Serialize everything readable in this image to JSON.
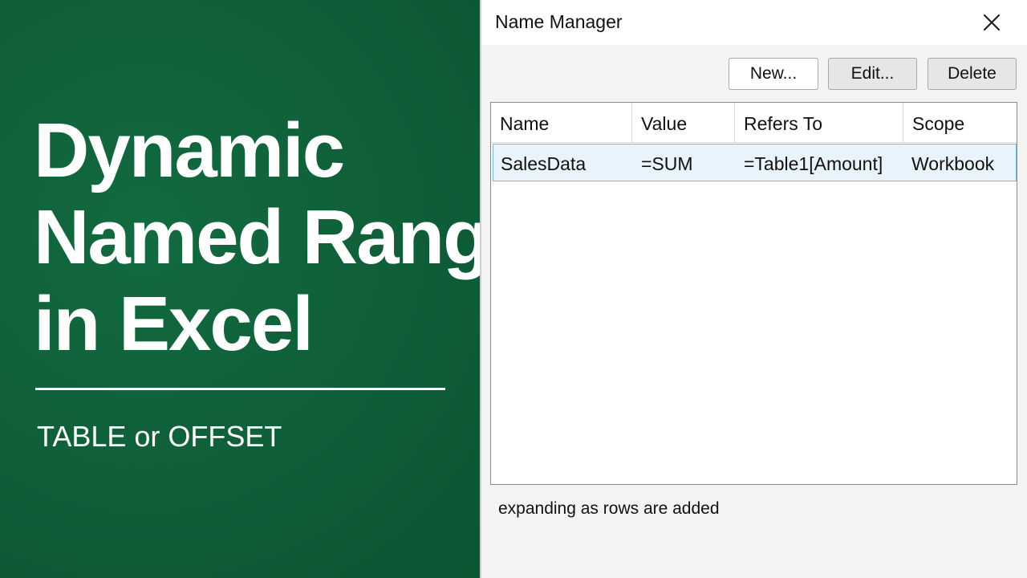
{
  "slide": {
    "headline_lines": [
      "Dynamic",
      "Named Range",
      "in Excel"
    ],
    "subheadline": "TABLE or OFFSET",
    "background_color": "#0f5e38"
  },
  "dialog": {
    "title": "Name Manager",
    "close_icon": "close-icon",
    "buttons": {
      "new": "New...",
      "edit": "Edit...",
      "delete": "Delete"
    },
    "columns": [
      "Name",
      "Value",
      "Refers To",
      "Scope"
    ],
    "rows": [
      {
        "name": "SalesData",
        "value": "=SUM",
        "refers_to": "=Table1[Amount]",
        "scope": "Workbook",
        "selected": true
      }
    ],
    "footer": "expanding as rows are added",
    "selection_color": "#e9f3fb"
  }
}
